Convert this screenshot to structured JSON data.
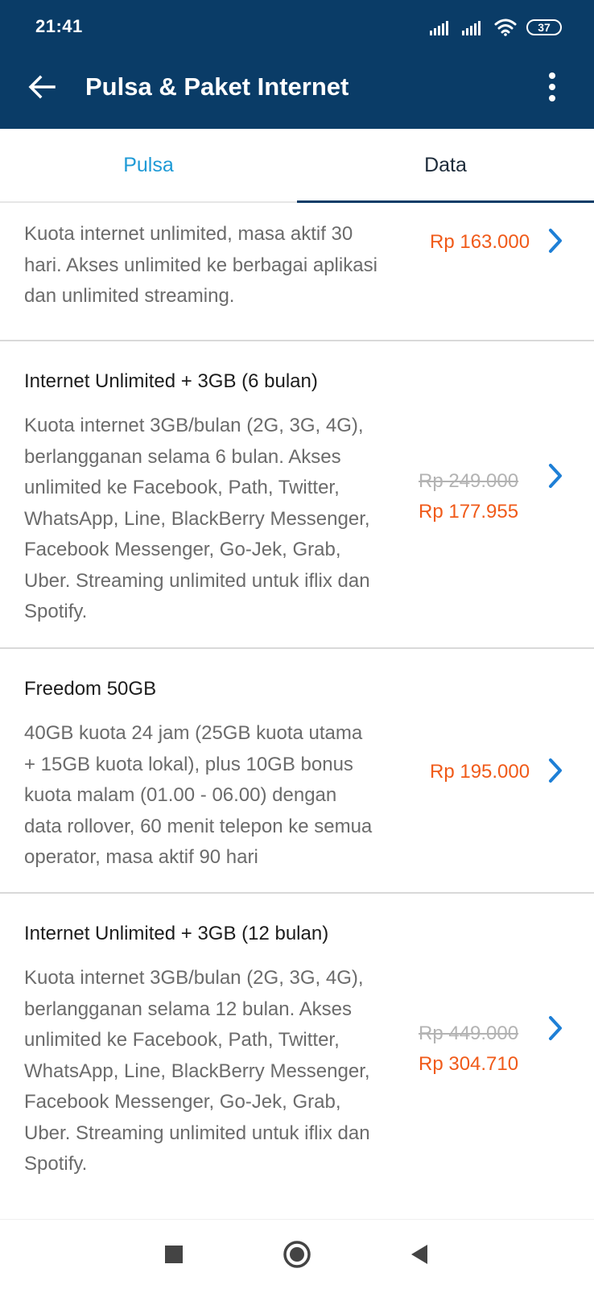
{
  "status_bar": {
    "time": "21:41",
    "battery": "37"
  },
  "app_bar": {
    "title": "Pulsa & Paket Internet"
  },
  "tabs": [
    {
      "label": "Pulsa"
    },
    {
      "label": "Data"
    }
  ],
  "items": [
    {
      "title": "",
      "description": "Kuota internet unlimited, masa aktif 30 hari. Akses unlimited ke berbagai aplikasi dan unlimited streaming.",
      "old_price": "",
      "price": "Rp 163.000"
    },
    {
      "title": "Internet Unlimited + 3GB (6 bulan)",
      "description": "Kuota internet 3GB/bulan (2G, 3G, 4G), berlangganan selama 6 bulan. Akses unlimited ke Facebook, Path, Twitter, WhatsApp, Line, BlackBerry Messenger, Facebook Messenger, Go-Jek, Grab, Uber. Streaming unlimited untuk iflix dan Spotify.",
      "old_price": "Rp 249.000",
      "price": "Rp 177.955"
    },
    {
      "title": "Freedom 50GB",
      "description": "40GB kuota 24 jam (25GB kuota utama + 15GB kuota lokal), plus 10GB bonus kuota malam (01.00 - 06.00) dengan data rollover, 60 menit telepon ke semua operator, masa aktif 90 hari",
      "old_price": "",
      "price": "Rp 195.000"
    },
    {
      "title": "Internet Unlimited + 3GB (12 bulan)",
      "description": "Kuota internet 3GB/bulan (2G, 3G, 4G), berlangganan selama 12 bulan. Akses unlimited ke Facebook, Path, Twitter, WhatsApp, Line, BlackBerry Messenger, Facebook Messenger, Go-Jek, Grab, Uber. Streaming unlimited untuk iflix dan Spotify.",
      "old_price": "Rp 449.000",
      "price": "Rp 304.710"
    }
  ],
  "colors": {
    "app_bar": "#0a3c67",
    "tab_active_text": "#1d2b3a",
    "tab_inactive_text": "#1e9ad6",
    "price": "#f05a19",
    "old_price": "#b3b3b3",
    "chevron": "#1e7fd6"
  },
  "icons": {
    "back": "arrow-left-icon",
    "more": "more-vertical-icon",
    "chevron": "chevron-right-icon",
    "nav_recents": "square-icon",
    "nav_home": "circle-icon",
    "nav_back": "triangle-left-icon"
  }
}
